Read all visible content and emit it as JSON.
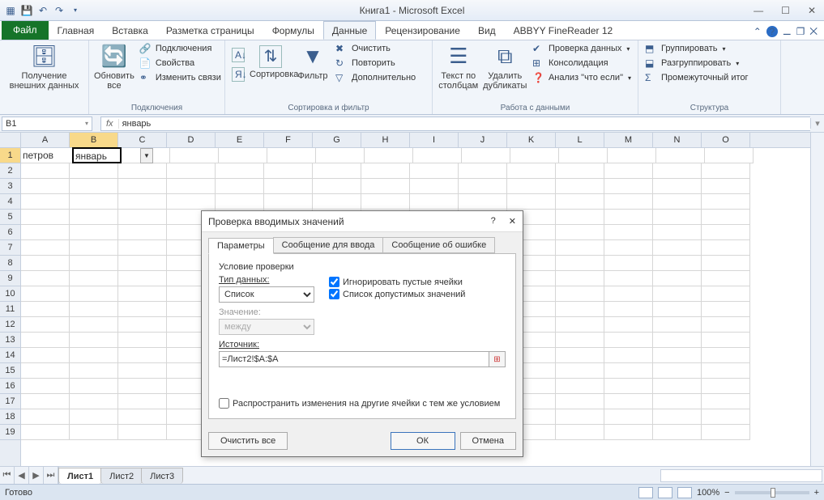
{
  "app": {
    "title": "Книга1  -  Microsoft Excel"
  },
  "tabs": {
    "file": "Файл",
    "items": [
      "Главная",
      "Вставка",
      "Разметка страницы",
      "Формулы",
      "Данные",
      "Рецензирование",
      "Вид",
      "ABBYY FineReader 12"
    ],
    "active": "Данные"
  },
  "ribbon": {
    "g1": {
      "big1": "Получение\nвнешних данных",
      "label": ""
    },
    "g2": {
      "big": "Обновить\nвсе",
      "s1": "Подключения",
      "s2": "Свойства",
      "s3": "Изменить связи",
      "label": "Подключения"
    },
    "g3": {
      "b1": "Сортировка",
      "b2": "Фильтр",
      "s1": "Очистить",
      "s2": "Повторить",
      "s3": "Дополнительно",
      "label": "Сортировка и фильтр"
    },
    "g4": {
      "b1": "Текст по\nстолбцам",
      "b2": "Удалить\nдубликаты",
      "s1": "Проверка данных",
      "s2": "Консолидация",
      "s3": "Анализ \"что если\"",
      "label": "Работа с данными"
    },
    "g5": {
      "s1": "Группировать",
      "s2": "Разгруппировать",
      "s3": "Промежуточный итог",
      "label": "Структура"
    }
  },
  "namebox": "B1",
  "formula": "январь",
  "columns": [
    "A",
    "B",
    "C",
    "D",
    "E",
    "F",
    "G",
    "H",
    "I",
    "J",
    "K",
    "L",
    "M",
    "N",
    "O"
  ],
  "rows": 19,
  "cells": {
    "A1": "петров",
    "B1": "январь"
  },
  "sheets": {
    "active": "Лист1",
    "all": [
      "Лист1",
      "Лист2",
      "Лист3"
    ]
  },
  "status": {
    "ready": "Готово",
    "zoom": "100%"
  },
  "dialog": {
    "title": "Проверка вводимых значений",
    "tabs": [
      "Параметры",
      "Сообщение для ввода",
      "Сообщение об ошибке"
    ],
    "tab_active": "Параметры",
    "cond_label": "Условие проверки",
    "type_label": "Тип данных:",
    "type_value": "Список",
    "value_label": "Значение:",
    "value_value": "между",
    "source_label": "Источник:",
    "source_value": "=Лист2!$A:$A",
    "chk_ignore": "Игнорировать пустые ячейки",
    "chk_list": "Список допустимых значений",
    "chk_spread": "Распространить изменения на другие ячейки с тем же условием",
    "btn_clear": "Очистить все",
    "btn_ok": "ОК",
    "btn_cancel": "Отмена"
  }
}
